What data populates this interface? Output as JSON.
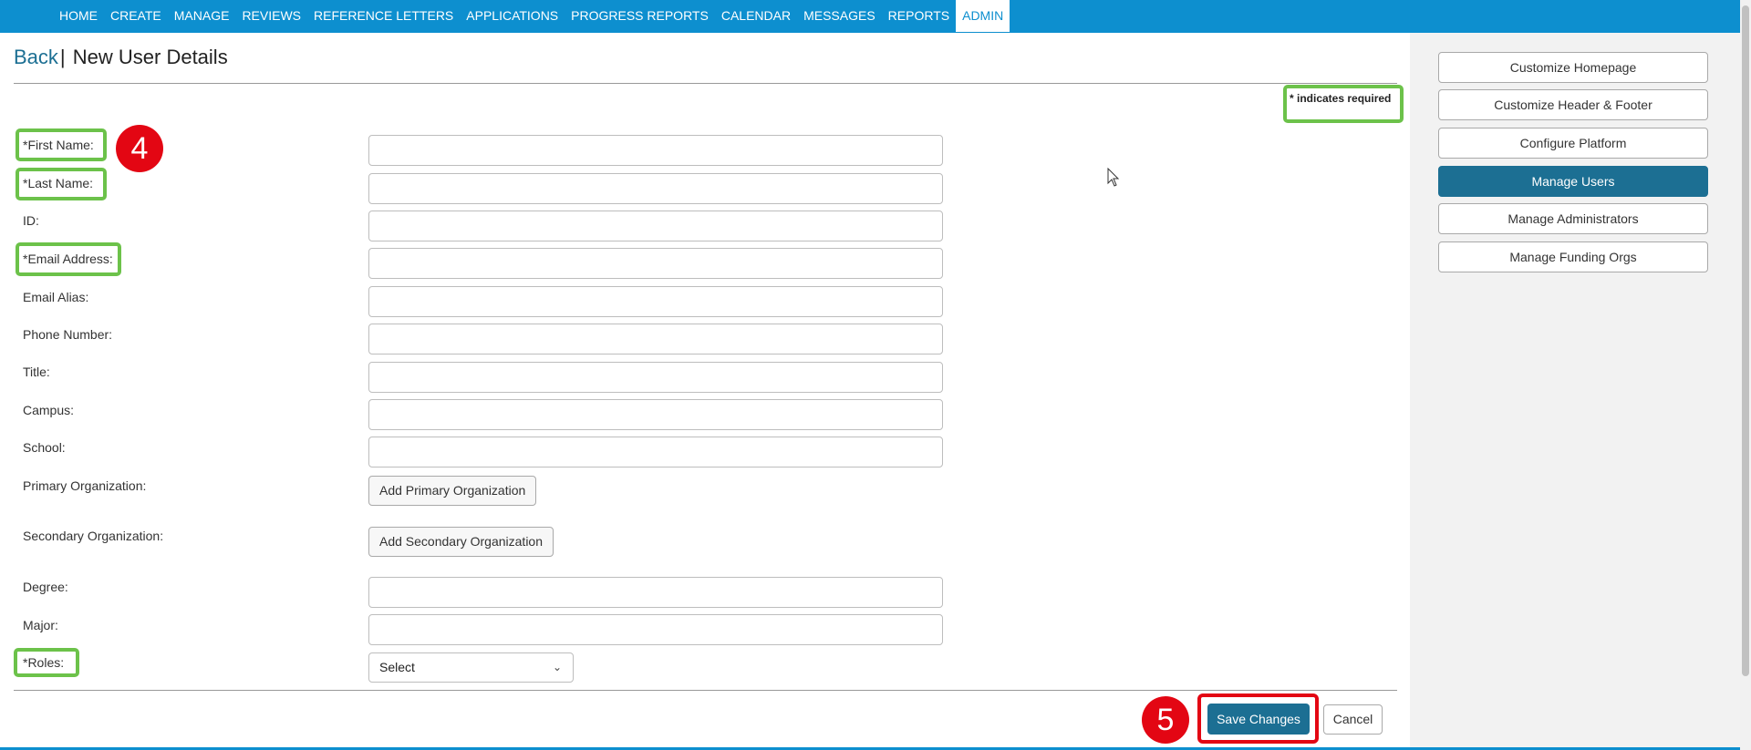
{
  "nav": {
    "items": [
      "HOME",
      "CREATE",
      "MANAGE",
      "REVIEWS",
      "REFERENCE LETTERS",
      "APPLICATIONS",
      "PROGRESS REPORTS",
      "CALENDAR",
      "MESSAGES",
      "REPORTS",
      "ADMIN"
    ],
    "active": "ADMIN"
  },
  "header": {
    "back_label": "Back",
    "separator": "|",
    "title": "New User Details"
  },
  "required_note": "* indicates required",
  "form": {
    "first_name_label": "*First Name:",
    "last_name_label": "*Last Name:",
    "id_label": "ID:",
    "email_label": "*Email Address:",
    "email_alias_label": "Email Alias:",
    "phone_label": "Phone Number:",
    "title_label": "Title:",
    "campus_label": "Campus:",
    "school_label": "School:",
    "primary_org_label": "Primary Organization:",
    "add_primary_org_button": "Add Primary Organization",
    "secondary_org_label": "Secondary Organization:",
    "add_secondary_org_button": "Add Secondary Organization",
    "degree_label": "Degree:",
    "major_label": "Major:",
    "roles_label": "*Roles:",
    "roles_select_value": "Select"
  },
  "actions": {
    "save_label": "Save Changes",
    "cancel_label": "Cancel"
  },
  "sidebar": {
    "items": [
      {
        "label": "Customize Homepage"
      },
      {
        "label": "Customize Header & Footer"
      },
      {
        "label": "Configure Platform"
      },
      {
        "label": "Manage Users"
      },
      {
        "label": "Manage Administrators"
      },
      {
        "label": "Manage Funding Orgs"
      }
    ],
    "active": "Manage Users"
  },
  "annotations": {
    "step_4": "4",
    "step_5": "5"
  },
  "colors": {
    "nav_bg": "#0d8fcf",
    "primary": "#1c6f93",
    "highlight_green": "#6cc24a",
    "highlight_red": "#e30613"
  }
}
